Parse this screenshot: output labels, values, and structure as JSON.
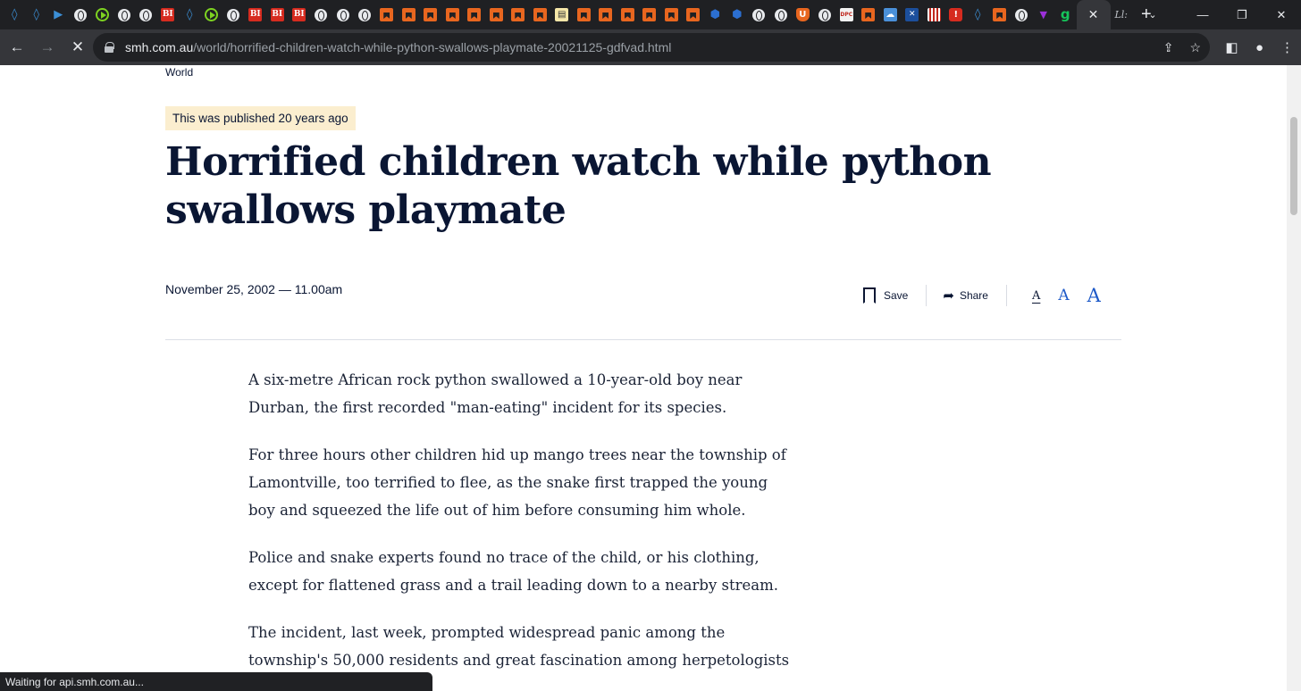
{
  "browser": {
    "tabs": [
      {
        "icon": "shield-icon",
        "glyph": "◊",
        "kind": "shield"
      },
      {
        "icon": "shield-icon",
        "glyph": "◊",
        "kind": "shield"
      },
      {
        "icon": "tag-icon",
        "glyph": "▶",
        "kind": "shield"
      },
      {
        "icon": "globe-icon",
        "glyph": "",
        "kind": "globe"
      },
      {
        "icon": "play-icon",
        "glyph": "",
        "kind": "play"
      },
      {
        "icon": "globe-icon",
        "glyph": "",
        "kind": "globe"
      },
      {
        "icon": "globe-icon",
        "glyph": "",
        "kind": "globe"
      },
      {
        "icon": "bi-icon",
        "glyph": "BI",
        "kind": "bi"
      },
      {
        "icon": "shield-icon",
        "glyph": "◊",
        "kind": "shield"
      },
      {
        "icon": "play-icon",
        "glyph": "",
        "kind": "play"
      },
      {
        "icon": "globe-icon",
        "glyph": "",
        "kind": "globe"
      },
      {
        "icon": "bi-icon",
        "glyph": "BI",
        "kind": "bi"
      },
      {
        "icon": "bi-icon",
        "glyph": "BI",
        "kind": "bi"
      },
      {
        "icon": "bi-icon",
        "glyph": "BI",
        "kind": "bi"
      },
      {
        "icon": "globe-icon",
        "glyph": "",
        "kind": "globe"
      },
      {
        "icon": "globe-icon",
        "glyph": "",
        "kind": "globe"
      },
      {
        "icon": "globe-icon",
        "glyph": "",
        "kind": "globe"
      },
      {
        "icon": "bookmark-icon",
        "glyph": "",
        "kind": "bookmark"
      },
      {
        "icon": "bookmark-icon",
        "glyph": "",
        "kind": "bookmark"
      },
      {
        "icon": "bookmark-icon",
        "glyph": "",
        "kind": "bookmark"
      },
      {
        "icon": "bookmark-icon",
        "glyph": "",
        "kind": "bookmark"
      },
      {
        "icon": "bookmark-icon",
        "glyph": "",
        "kind": "bookmark"
      },
      {
        "icon": "bookmark-icon",
        "glyph": "",
        "kind": "bookmark"
      },
      {
        "icon": "bookmark-icon",
        "glyph": "",
        "kind": "bookmark"
      },
      {
        "icon": "bookmark-icon",
        "glyph": "",
        "kind": "bookmark"
      },
      {
        "icon": "note-icon",
        "glyph": "▤",
        "kind": "note"
      },
      {
        "icon": "bookmark-icon",
        "glyph": "",
        "kind": "bookmark"
      },
      {
        "icon": "bookmark-icon",
        "glyph": "",
        "kind": "bookmark"
      },
      {
        "icon": "bookmark-icon",
        "glyph": "",
        "kind": "bookmark"
      },
      {
        "icon": "bookmark-icon",
        "glyph": "",
        "kind": "bookmark"
      },
      {
        "icon": "bookmark-icon",
        "glyph": "",
        "kind": "bookmark"
      },
      {
        "icon": "bookmark-icon",
        "glyph": "",
        "kind": "bookmark"
      },
      {
        "icon": "hexagon-icon",
        "glyph": "⬢",
        "kind": "hex"
      },
      {
        "icon": "hexagon-icon",
        "glyph": "⬢",
        "kind": "hex"
      },
      {
        "icon": "globe-icon",
        "glyph": "",
        "kind": "globe"
      },
      {
        "icon": "globe-icon",
        "glyph": "",
        "kind": "globe"
      },
      {
        "icon": "shield-outline-icon",
        "glyph": "U",
        "kind": "shieldo"
      },
      {
        "icon": "globe-icon",
        "glyph": "",
        "kind": "globe"
      },
      {
        "icon": "dpc-icon",
        "glyph": "DPC",
        "kind": "dpc"
      },
      {
        "icon": "bookmark-icon",
        "glyph": "",
        "kind": "bookmark"
      },
      {
        "icon": "cloud-icon",
        "glyph": "☁",
        "kind": "cloud"
      },
      {
        "icon": "flag-icon",
        "glyph": "✕",
        "kind": "flag"
      },
      {
        "icon": "stripes-icon",
        "glyph": "",
        "kind": "stripes"
      },
      {
        "icon": "pin-icon",
        "glyph": "!",
        "kind": "redpin"
      },
      {
        "icon": "shield-icon",
        "glyph": "◊",
        "kind": "shield"
      },
      {
        "icon": "bookmark-icon",
        "glyph": "",
        "kind": "bookmark"
      },
      {
        "icon": "globe-icon",
        "glyph": "",
        "kind": "globe"
      },
      {
        "icon": "triangle-icon",
        "glyph": "▼",
        "kind": "tri"
      },
      {
        "icon": "g-icon",
        "glyph": "g",
        "kind": "g"
      }
    ],
    "active_tab_close": "✕",
    "inactive_tab_after": "Ll:",
    "new_tab": "+",
    "url_host": "smh.com.au",
    "url_path": "/world/horrified-children-watch-while-python-swallows-playmate-20021125-gdfvad.html",
    "status_text": "Waiting for api.smh.com.au..."
  },
  "article": {
    "section": "World",
    "published_badge": "This was published 20 years ago",
    "headline": "Horrified children watch while python swallows playmate",
    "dateline": "November 25, 2002 — 11.00am",
    "save_label": "Save",
    "share_label": "Share",
    "font_small": "A",
    "font_medium": "A",
    "font_large": "A",
    "paragraphs": [
      "A six-metre African rock python swallowed a 10-year-old boy near Durban, the first recorded \"man-eating\" incident for its species.",
      "For three hours other children hid up mango trees near the township of Lamontville, too terrified to flee, as the snake first trapped the young boy and squeezed the life out of him before consuming him whole.",
      "Police and snake experts found no trace of the child, or his clothing, except for flattened grass and a trail leading down to a nearby stream.",
      "The incident, last week, prompted widespread panic among the township's 50,000 residents and great fascination among herpetologists across the country."
    ]
  },
  "colors": {
    "browser_frame": "#1f2023",
    "toolbar": "#35363a",
    "headline": "#0a1633",
    "badge_bg": "#fbeecf",
    "font_accent": "#1e5ac8"
  }
}
